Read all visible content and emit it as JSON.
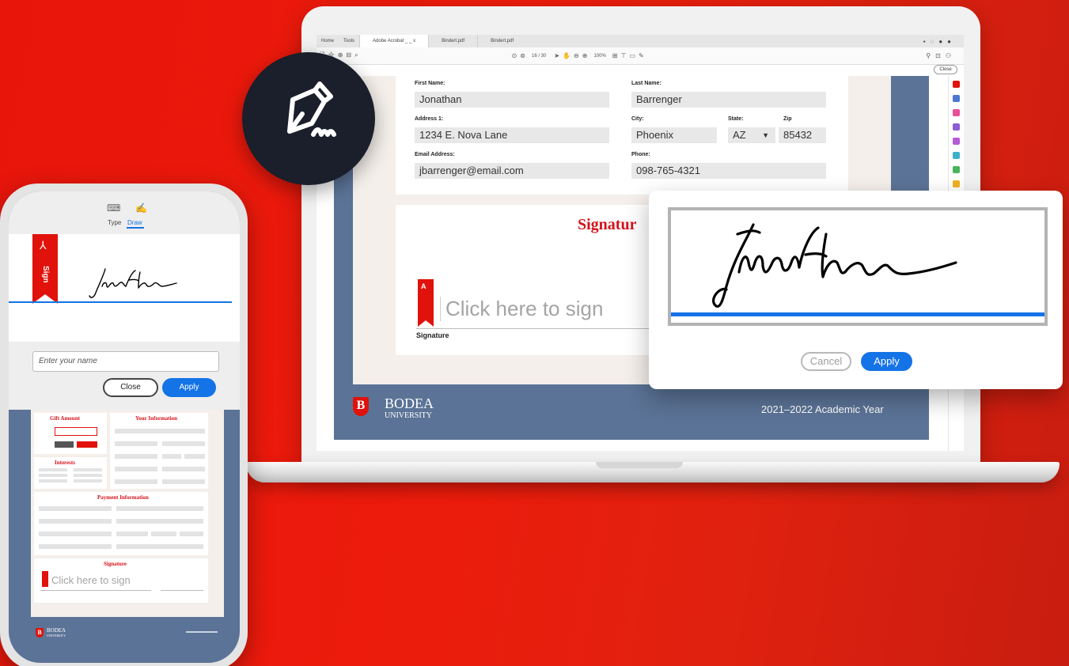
{
  "laptop": {
    "tabs": [
      "Home",
      "Tools",
      "Adobe Acrobat _ _ x",
      "Bindert.pdf",
      "Bindert.pdf"
    ],
    "toolbar_page": "16 / 30",
    "toolbar_zoom": "100%",
    "close_label": "Close",
    "form": {
      "first_name_label": "First Name:",
      "first_name_value": "Jonathan",
      "last_name_label": "Last Name:",
      "last_name_value": "Barrenger",
      "address_label": "Address 1:",
      "address_value": "1234 E. Nova Lane",
      "city_label": "City:",
      "city_value": "Phoenix",
      "state_label": "State:",
      "state_value": "AZ",
      "zip_label": "Zip",
      "zip_value": "85432",
      "email_label": "Email Address:",
      "email_value": "jbarrenger@email.com",
      "phone_label": "Phone:",
      "phone_value": "098-765-4321"
    },
    "signature_section": {
      "title": "Signatur",
      "placeholder": "Click here to sign",
      "label": "Signature",
      "ribbon_text": "Adobe"
    },
    "footer": {
      "logo_letter": "B",
      "university_name": "BODEA",
      "university_sub": "UNIVERSITY",
      "academic_year": "2021–2022 Academic Year"
    }
  },
  "sign_badge": {
    "icon": "pen-sign-icon"
  },
  "signature_dialog": {
    "signature": "Jonathan",
    "cancel_label": "Cancel",
    "apply_label": "Apply"
  },
  "phone": {
    "mode_type_label": "Type",
    "mode_draw_label": "Draw",
    "ribbon_text": "Sign",
    "signature": "Jonathan",
    "name_placeholder": "Enter your name",
    "close_label": "Close",
    "apply_label": "Apply",
    "doc": {
      "gift_title": "Gift Amount",
      "info_title": "Your Information",
      "interests_title": "Interests",
      "payment_title": "Payment Information",
      "signature_title": "Signature",
      "click_sign": "Click here to sign",
      "university_name": "BODEA",
      "university_sub": "UNIVERSITY",
      "logo_letter": "B"
    }
  },
  "colors": {
    "background_red": "#ec1c0c",
    "adobe_red": "#e0120b",
    "accent_blue": "#1473e6",
    "doc_frame_blue": "#5b7396",
    "badge_dark": "#1a1f2b"
  }
}
